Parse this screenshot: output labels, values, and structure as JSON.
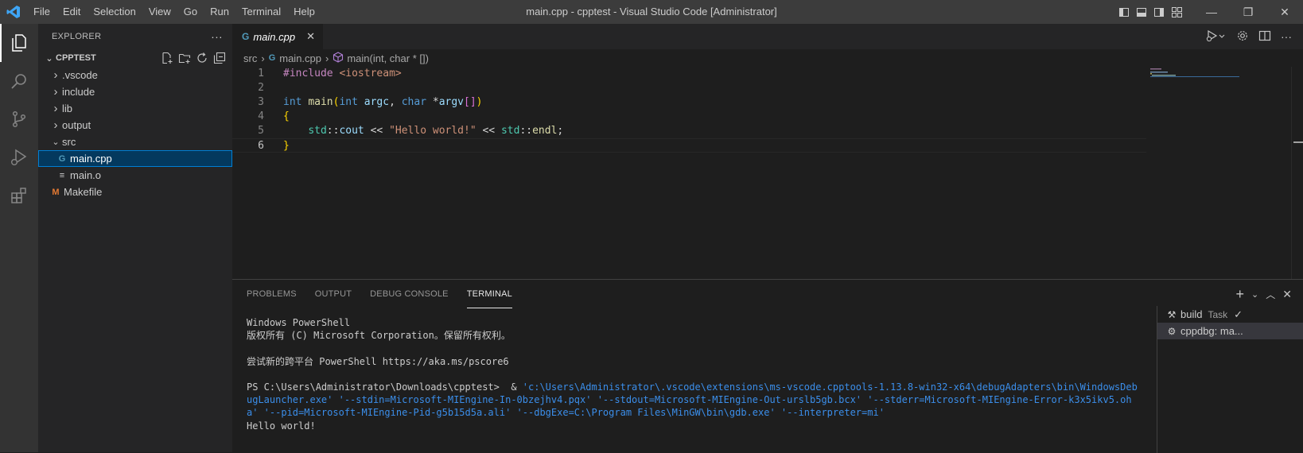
{
  "titlebar": {
    "menu": [
      "File",
      "Edit",
      "Selection",
      "View",
      "Go",
      "Run",
      "Terminal",
      "Help"
    ],
    "title": "main.cpp - cpptest - Visual Studio Code [Administrator]",
    "minimize": "—",
    "restore": "❐",
    "close": "✕"
  },
  "activity": {
    "items": [
      "files-icon",
      "search-icon",
      "source-control-icon",
      "run-debug-icon",
      "extensions-icon"
    ]
  },
  "sidebar": {
    "title": "EXPLORER",
    "more": "···",
    "folder": "CPPTEST",
    "tree": [
      {
        "label": ".vscode",
        "type": "folder",
        "expanded": false
      },
      {
        "label": "include",
        "type": "folder",
        "expanded": false
      },
      {
        "label": "lib",
        "type": "folder",
        "expanded": false
      },
      {
        "label": "output",
        "type": "folder",
        "expanded": false
      },
      {
        "label": "src",
        "type": "folder",
        "expanded": true
      },
      {
        "label": "main.cpp",
        "type": "cpp",
        "selected": true
      },
      {
        "label": "main.o",
        "type": "obj"
      },
      {
        "label": "Makefile",
        "type": "make"
      }
    ]
  },
  "editor": {
    "tab": {
      "label": "main.cpp",
      "icon": "G",
      "close": "✕"
    },
    "breadcrumb": {
      "folder": "src",
      "file": "main.cpp",
      "symbol": "main(int, char * [])"
    },
    "lines": [
      {
        "num": "1",
        "tokens": [
          {
            "t": "#include ",
            "c": "#c586c0"
          },
          {
            "t": "<iostream>",
            "c": "#ce9178"
          }
        ]
      },
      {
        "num": "2",
        "tokens": []
      },
      {
        "num": "3",
        "tokens": [
          {
            "t": "int",
            "c": "#569cd6"
          },
          {
            "t": " ",
            "c": "#d4d4d4"
          },
          {
            "t": "main",
            "c": "#dcdcaa"
          },
          {
            "t": "(",
            "c": "#ffd700"
          },
          {
            "t": "int",
            "c": "#569cd6"
          },
          {
            "t": " ",
            "c": "#d4d4d4"
          },
          {
            "t": "argc",
            "c": "#9cdcfe"
          },
          {
            "t": ", ",
            "c": "#d4d4d4"
          },
          {
            "t": "char",
            "c": "#569cd6"
          },
          {
            "t": " *",
            "c": "#d4d4d4"
          },
          {
            "t": "argv",
            "c": "#9cdcfe"
          },
          {
            "t": "[]",
            "c": "#da70d6"
          },
          {
            "t": ")",
            "c": "#ffd700"
          }
        ]
      },
      {
        "num": "4",
        "tokens": [
          {
            "t": "{",
            "c": "#ffd700"
          }
        ]
      },
      {
        "num": "5",
        "tokens": [
          {
            "t": "    ",
            "c": "#d4d4d4"
          },
          {
            "t": "std",
            "c": "#4ec9b0"
          },
          {
            "t": "::",
            "c": "#d4d4d4"
          },
          {
            "t": "cout",
            "c": "#9cdcfe"
          },
          {
            "t": " << ",
            "c": "#d4d4d4"
          },
          {
            "t": "\"Hello world!\"",
            "c": "#ce9178"
          },
          {
            "t": " << ",
            "c": "#d4d4d4"
          },
          {
            "t": "std",
            "c": "#4ec9b0"
          },
          {
            "t": "::",
            "c": "#d4d4d4"
          },
          {
            "t": "endl",
            "c": "#dcdcaa"
          },
          {
            "t": ";",
            "c": "#d4d4d4"
          }
        ]
      },
      {
        "num": "6",
        "tokens": [
          {
            "t": "}",
            "c": "#ffd700"
          }
        ],
        "current": true
      }
    ]
  },
  "panel": {
    "tabs": [
      "PROBLEMS",
      "OUTPUT",
      "DEBUG CONSOLE",
      "TERMINAL"
    ],
    "active_tab": "TERMINAL",
    "terminal_lines": [
      {
        "segments": [
          {
            "t": "Windows PowerShell",
            "c": ""
          }
        ]
      },
      {
        "segments": [
          {
            "t": "版权所有 (C) Microsoft Corporation。保留所有权利。",
            "c": ""
          }
        ]
      },
      {
        "segments": [
          {
            "t": "",
            "c": ""
          }
        ]
      },
      {
        "segments": [
          {
            "t": "尝试新的跨平台 PowerShell https://aka.ms/pscore6",
            "c": ""
          }
        ]
      },
      {
        "segments": [
          {
            "t": "",
            "c": ""
          }
        ]
      },
      {
        "segments": [
          {
            "t": "PS C:\\Users\\Administrator\\Downloads\\cpptest>  & ",
            "c": ""
          },
          {
            "t": "'c:\\Users\\Administrator\\.vscode\\extensions\\ms-vscode.cpptools-1.13.8-win32-x64\\debugAdapters\\bin\\WindowsDebugLauncher.exe' '--stdin=Microsoft-MIEngine-In-0bzejhv4.pqx' '--stdout=Microsoft-MIEngine-Out-urslb5gb.bcx' '--stderr=Microsoft-MIEngine-Error-k3x5ikv5.oha' '--pid=Microsoft-MIEngine-Pid-g5b15d5a.ali' '--dbgExe=C:\\Program Files\\MinGW\\bin\\gdb.exe' '--interpreter=mi'",
            "c": "blue"
          }
        ]
      },
      {
        "segments": [
          {
            "t": "Hello world!",
            "c": ""
          }
        ]
      }
    ],
    "terminals": [
      {
        "label": "build",
        "task": "Task",
        "check": "✓",
        "icon": "tools-icon"
      },
      {
        "label": "cppdbg: ma...",
        "icon": "debug-icon"
      }
    ]
  }
}
